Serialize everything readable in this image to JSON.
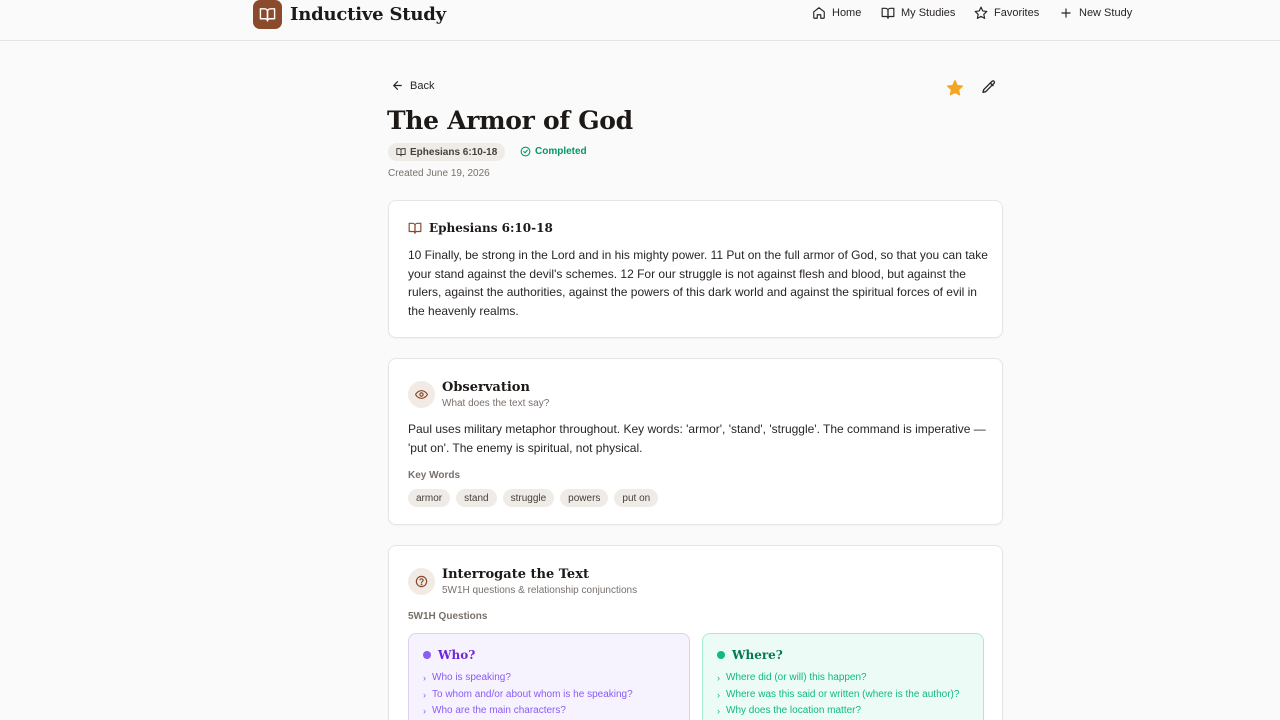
{
  "app": {
    "brand": "Inductive Study"
  },
  "nav": {
    "home": "Home",
    "my_studies": "My Studies",
    "favorites": "Favorites",
    "new_study": "New Study"
  },
  "header": {
    "back": "Back",
    "title": "The Armor of God",
    "reference": "Ephesians 6:10-18",
    "status": "Completed",
    "created": "Created June 19, 2026",
    "favorite_color": "#f5a524"
  },
  "passage": {
    "reference": "Ephesians 6:10-18",
    "text": "10 Finally, be strong in the Lord and in his mighty power. 11 Put on the full armor of God, so that you can take your stand against the devil's schemes. 12 For our struggle is not against flesh and blood, but against the rulers, against the authorities, against the powers of this dark world and against the spiritual forces of evil in the heavenly realms."
  },
  "observation": {
    "title": "Observation",
    "subtitle": "What does the text say?",
    "text": "Paul uses military metaphor throughout. Key words: 'armor', 'stand', 'struggle'. The command is imperative — 'put on'. The enemy is spiritual, not physical.",
    "key_words_label": "Key Words",
    "key_words": [
      "armor",
      "stand",
      "struggle",
      "powers",
      "put on"
    ]
  },
  "interrogate": {
    "title": "Interrogate the Text",
    "subtitle": "5W1H questions & relationship conjunctions",
    "questions_label": "5W1H Questions",
    "who": {
      "title": "Who?",
      "color": "#8b5cf6",
      "items": [
        "Who is speaking?",
        "To whom and/or about whom is he speaking?",
        "Who are the main characters?"
      ]
    },
    "where": {
      "title": "Where?",
      "color": "#10b981",
      "items": [
        "Where did (or will) this happen?",
        "Where was this said or written (where is the author)?",
        "Why does the location matter?"
      ]
    }
  }
}
